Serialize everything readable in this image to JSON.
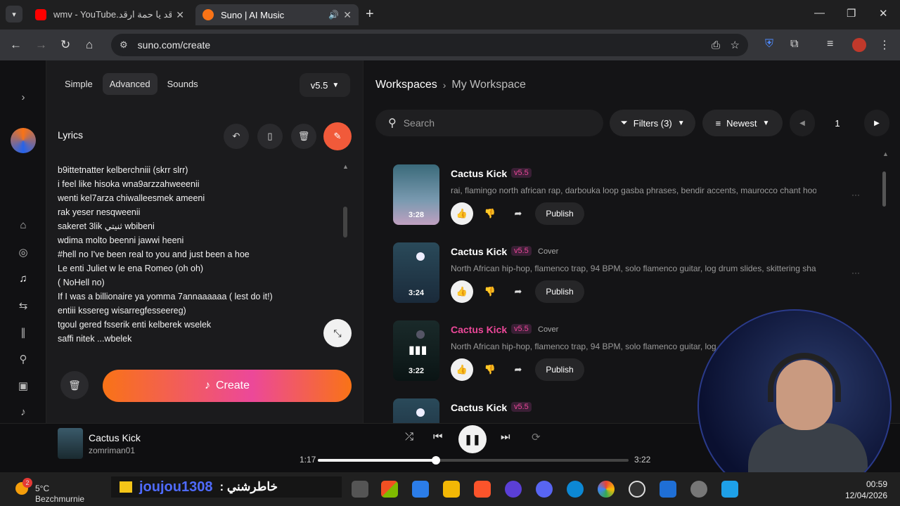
{
  "browser": {
    "tabs": [
      {
        "title": "wmv - YouTube.ارقد يا حمة ارقد",
        "active": false,
        "favicon_color": "#ff0000"
      },
      {
        "title": "Suno | AI Music",
        "active": true,
        "favicon_color": "#f97316"
      }
    ],
    "url": "suno.com/create"
  },
  "left_panel": {
    "mode_tabs": [
      "Simple",
      "Advanced",
      "Sounds"
    ],
    "selected_mode": "Advanced",
    "version": "v5.5",
    "lyrics_label": "Lyrics",
    "lyrics_lines": [
      "b9ittetnatter kelberchniii (skrr slrr)",
      "i feel like hisoka wna9arzzahweeenii",
      "wenti kel7arza chiwalleesmek ameeni",
      "rak yeser nesqweenii",
      "sakeret 3lik ثنيتي wbibeni",
      "wdima molto beenni jawwi heeni",
      "#hell no I've been real to you and just been a hoe",
      " Le enti Juliet w le ena Romeo (oh oh)",
      "( NoHell no)",
      " If I was a billionaire ya yomma 7annaaaaaa ( lest do it!)",
      "entiii kssereg  wisarregfesseereg)",
      "tgoul gered fsserik enti kelberek wselek",
      "saffi nitek ...wbelek"
    ],
    "create_label": "Create"
  },
  "right_panel": {
    "breadcrumb": {
      "root": "Workspaces",
      "current": "My Workspace"
    },
    "search_placeholder": "Search",
    "filters_label": "Filters (3)",
    "sort_label": "Newest",
    "page_number": "1",
    "songs": [
      {
        "title": "Cactus Kick",
        "version": "v5.5",
        "tag": "",
        "description": "rai, flamingo north african rap, darbouka loop gasba phrases, bendir accents, maurocco chant hook...",
        "duration": "3:28",
        "publish_label": "Publish"
      },
      {
        "title": "Cactus Kick",
        "version": "v5.5",
        "tag": "Cover",
        "description": "North African hip-hop, flamenco trap, 94 BPM, solo flamenco guitar, log drum slides, skittering shake...",
        "duration": "3:24",
        "publish_label": "Publish"
      },
      {
        "title": "Cactus Kick",
        "version": "v5.5",
        "tag": "Cover",
        "description": "North African hip-hop, flamenco trap, 94 BPM, solo flamenco guitar, log drum",
        "duration": "3:22",
        "publish_label": "Publish"
      },
      {
        "title": "Cactus Kick",
        "version": "v5.5",
        "tag": "",
        "description": "",
        "duration": "",
        "publish_label": ""
      }
    ]
  },
  "player": {
    "title": "Cactus Kick",
    "artist": "zomriman01",
    "elapsed": "1:17",
    "total": "3:22",
    "progress_fraction": 0.38
  },
  "taskbar": {
    "notification_count": "2",
    "temperature": "5°C",
    "location": "Bezchmurnie",
    "overlay_user": "joujou1308",
    "overlay_message": ": خاطرشني",
    "time": "00:59",
    "date": "12/04/2026"
  }
}
